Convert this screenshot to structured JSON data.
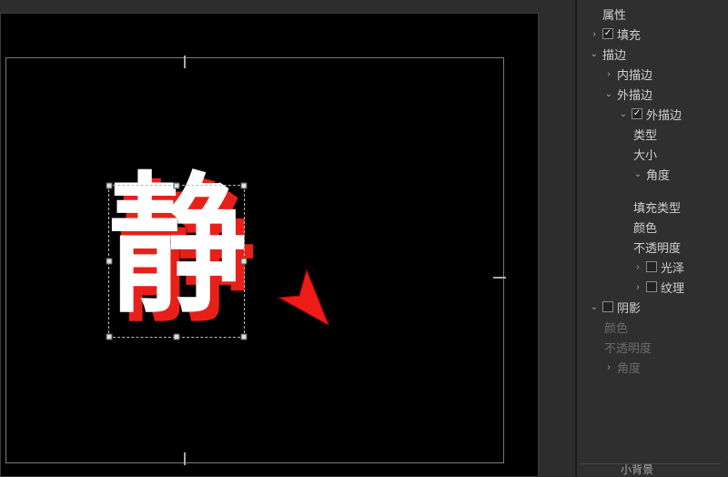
{
  "canvas": {
    "glyph": "静"
  },
  "panel": {
    "properties": "属性",
    "fill": "填充",
    "stroke": "描边",
    "inner_stroke": "内描边",
    "outer_stroke": "外描边",
    "outer_stroke_item": "外描边",
    "type": "类型",
    "size": "大小",
    "angle": "角度",
    "fill_type": "填充类型",
    "color": "颜色",
    "opacity": "不透明度",
    "gloss": "光泽",
    "texture": "纹理",
    "shadow": "阴影",
    "shadow_color": "颜色",
    "shadow_opacity": "不透明度",
    "shadow_angle": "角度",
    "footer": "小背景"
  }
}
